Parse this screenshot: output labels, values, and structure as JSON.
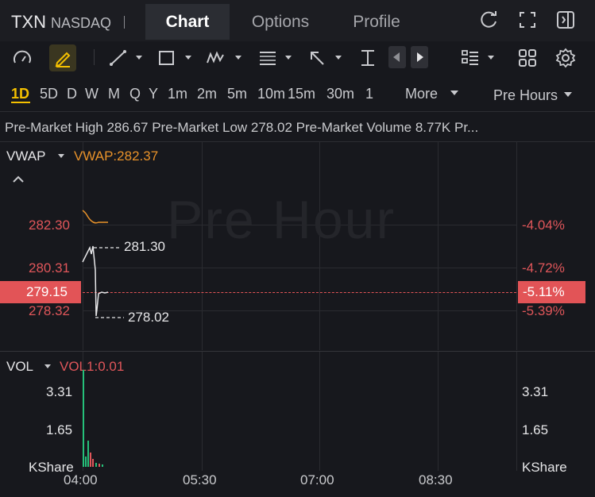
{
  "header": {
    "ticker": "TXN",
    "exchange": "NASDAQ",
    "tabs": [
      "Chart",
      "Options",
      "Profile"
    ],
    "active_tab": "Chart",
    "icons": [
      "refresh-icon",
      "fullscreen-icon",
      "panel-toggle-icon"
    ]
  },
  "toolbar": {
    "icons": [
      "indicator-gauge-icon",
      "draw-pencil-icon",
      "trend-line-icon",
      "rectangle-icon",
      "pattern-icon",
      "fib-icon",
      "arrow-icon",
      "price-range-icon",
      "prev-icon",
      "next-icon",
      "layout-icon",
      "grid-icon",
      "settings-icon"
    ]
  },
  "intervals": {
    "items": [
      "1D",
      "5D",
      "D",
      "W",
      "M",
      "Q",
      "Y",
      "1m",
      "2m",
      "5m",
      "10m",
      "15m",
      "30m",
      "1"
    ],
    "active": "1D",
    "more_label": "More",
    "session_label": "Pre Hours"
  },
  "info": {
    "text": "Pre-Market High 286.67  Pre-Market Low 278.02  Pre-Market Volume 8.77K  Pr..."
  },
  "main_chart": {
    "indicator_name": "VWAP",
    "indicator_value": "VWAP:282.37",
    "watermark": "Pre Hour",
    "price_labels": [
      "282.30",
      "280.31",
      "278.32"
    ],
    "current_price": "279.15",
    "pct_labels": [
      "-4.04%",
      "-4.72%",
      "-5.39%"
    ],
    "current_pct": "-5.11%",
    "high_marker": "281.30",
    "low_marker": "278.02",
    "colors": {
      "down": "#e0565a",
      "vwap": "#e8922a",
      "up": "#25c07a"
    }
  },
  "volume_chart": {
    "indicator_name": "VOL",
    "indicator_value": "VOL1:0.01",
    "left_labels": [
      "3.31",
      "1.65",
      "KShare"
    ],
    "right_labels": [
      "3.31",
      "1.65",
      "KShare"
    ]
  },
  "time_axis": [
    "04:00",
    "05:30",
    "07:00",
    "08:30"
  ]
}
